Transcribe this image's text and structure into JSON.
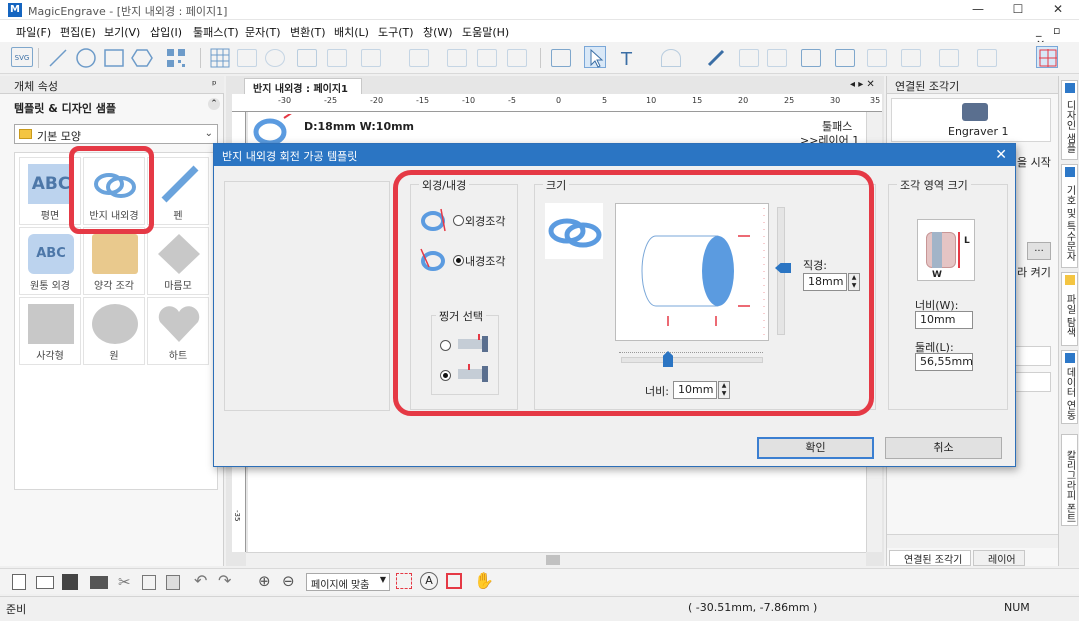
{
  "app": {
    "title": "MagicEngrave - [반지 내외경 : 페이지1]",
    "logo_letter": "M"
  },
  "window_controls": {
    "minimize": "—",
    "maximize": "☐",
    "close": "✕"
  },
  "mdi_controls": "_ ▫ ×",
  "menu": [
    "파일(F)",
    "편집(E)",
    "보기(V)",
    "삽입(I)",
    "툴패스(T)",
    "문자(T)",
    "변환(T)",
    "배치(L)",
    "도구(T)",
    "창(W)",
    "도움말(H)"
  ],
  "toolbar": {
    "svg_label": "SVG"
  },
  "left_panel": {
    "header": "개체 속성",
    "pin": "ᵖ",
    "section_title": "템플릿 & 디자인 샘플",
    "collapse": "⌃",
    "combo_value": "기본 모양",
    "tiles": [
      {
        "label": "평면",
        "thumb_text": "ABC"
      },
      {
        "label": "반지 내외경",
        "thumb_text": ""
      },
      {
        "label": "펜",
        "thumb_text": ""
      },
      {
        "label": "원통 외경",
        "thumb_text": "ABC"
      },
      {
        "label": "양각 조각",
        "thumb_text": ""
      },
      {
        "label": "마름모",
        "thumb_text": ""
      },
      {
        "label": "사각형",
        "thumb_text": ""
      },
      {
        "label": "원",
        "thumb_text": ""
      },
      {
        "label": "하트",
        "thumb_text": ""
      }
    ]
  },
  "document": {
    "tab": "반지 내외경 : 페이지1",
    "tab_nav": "◂ ▸ ✕",
    "ruler_labels": [
      "-30",
      "-25",
      "-20",
      "-15",
      "-10",
      "-5",
      "0",
      "5",
      "10",
      "15",
      "20",
      "25",
      "30",
      "35"
    ],
    "ruler_vertical_label": "-35",
    "dimension_text": "D:18mm  W:10mm",
    "toolpath_text": "툴패스",
    "layer_text": ">>레이어 1"
  },
  "right_panel": {
    "header": "연결된 조각기",
    "device_name": "Engraver 1",
    "clipped_text_1": "을 시작",
    "clipped_text_2": "라 켜기",
    "browse": "...",
    "bottom_tabs": [
      "연결된 조각기",
      "레이어"
    ]
  },
  "side_tabs": [
    "디자인 샘플",
    "기호 및 특수문자",
    "파일 탐색",
    "데이터 연동",
    "칼리그라피 폰트"
  ],
  "bottom_toolbar": {
    "fit_page": "페이지에 맞춤"
  },
  "status": {
    "left": "준비",
    "coords": "( -30.51mm, -7.86mm )",
    "num": "NUM"
  },
  "dialog": {
    "title": "반지 내외경 회전 가공 템플릿",
    "close": "✕",
    "group_outer_inner": {
      "label": "외경/내경",
      "option_outer": "외경조각",
      "option_inner": "내경조각",
      "selected": "내경조각"
    },
    "group_hinge": {
      "label": "찡거 선택",
      "selected_index": 1
    },
    "group_size": {
      "label": "크기",
      "diameter_label": "직경:",
      "diameter_value": "18mm",
      "width_label": "너비:",
      "width_value": "10mm"
    },
    "group_area": {
      "label": "조각 영역 크기",
      "width_label": "너비(W):",
      "width_value": "10mm",
      "circ_label": "둘레(L):",
      "circ_value": "56,55mm",
      "diagram_L": "L",
      "diagram_W": "W"
    },
    "ok": "확인",
    "cancel": "취소"
  },
  "colors": {
    "accent_blue": "#2b75c3",
    "highlight_red": "#e53945",
    "ring_blue": "#5b9be0"
  }
}
